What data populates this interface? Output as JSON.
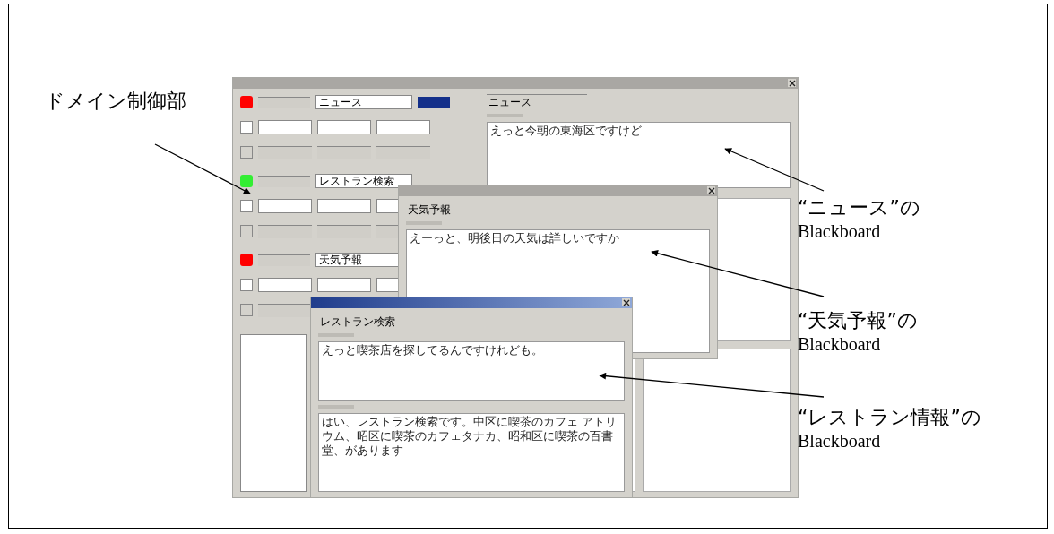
{
  "screenshot": {
    "control_window": {
      "domains": [
        {
          "name": "ニュース",
          "color": "#ff0000",
          "highlighted": true
        },
        {
          "name": "レストラン検索",
          "color": "#33ee33",
          "highlighted": false
        },
        {
          "name": "天気予報",
          "color": "#ff0000",
          "highlighted": false
        }
      ]
    },
    "blackboards": [
      {
        "kind": "news",
        "active": false,
        "domain_name": "ニュース",
        "user_utterance": "えっと今朝の東海区ですけど"
      },
      {
        "kind": "weather",
        "active": false,
        "domain_name": "天気予報",
        "user_utterance": "えーっと、明後日の天気は詳しいですか"
      },
      {
        "kind": "restaurant",
        "active": true,
        "domain_name": "レストラン検索",
        "user_utterance": "えっと喫茶店を探してるんですけれども。",
        "system_response": "はい、レストラン検索です。中区に喫茶のカフェ アトリウム、昭区に喫茶のカフェタナカ、昭和区に喫茶の百書堂、があります"
      }
    ]
  },
  "annotations": [
    {
      "label": "ドメイン制御部"
    },
    {
      "label": "“ニュース”の",
      "sublabel": "Blackboard"
    },
    {
      "label": "“天気予報”の",
      "sublabel": "Blackboard"
    },
    {
      "label": "“レストラン情報”の",
      "sublabel": "Blackboard"
    }
  ]
}
